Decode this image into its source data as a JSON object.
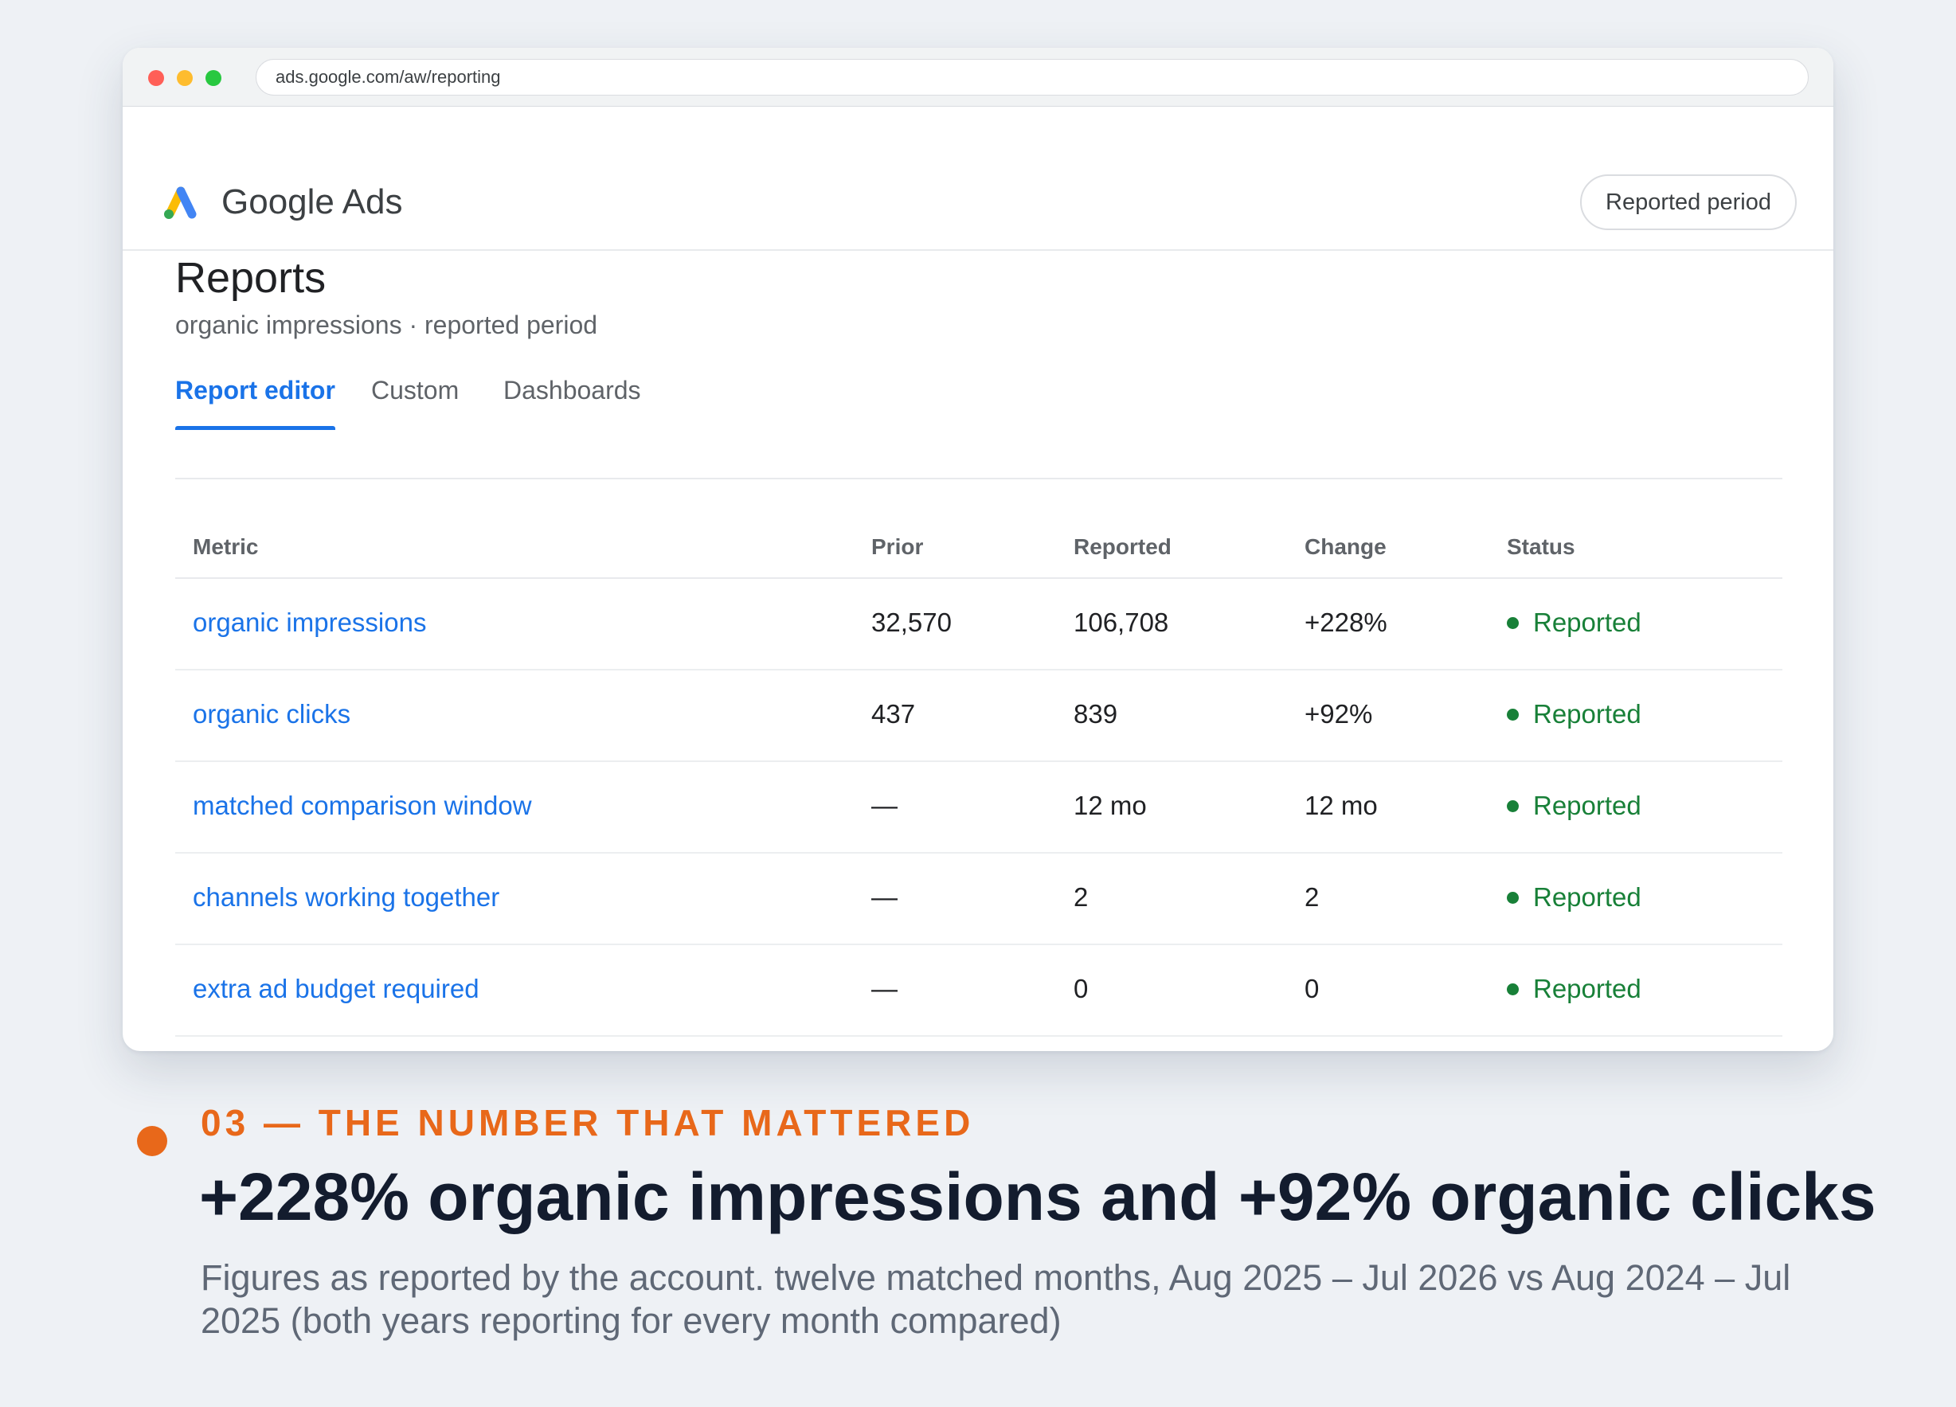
{
  "browser": {
    "url": "ads.google.com/aw/reporting"
  },
  "app": {
    "name": "Google Ads",
    "period_button": "Reported period"
  },
  "page": {
    "title": "Reports",
    "subtitle": "organic impressions · reported period"
  },
  "tabs": [
    {
      "label": "Report editor",
      "active": true
    },
    {
      "label": "Custom",
      "active": false
    },
    {
      "label": "Dashboards",
      "active": false
    }
  ],
  "table": {
    "columns": [
      "Metric",
      "Prior",
      "Reported",
      "Change",
      "Status"
    ],
    "rows": [
      {
        "metric": "organic impressions",
        "prior": "32,570",
        "reported": "106,708",
        "change": "+228%",
        "status": "Reported"
      },
      {
        "metric": "organic clicks",
        "prior": "437",
        "reported": "839",
        "change": "+92%",
        "status": "Reported"
      },
      {
        "metric": "matched comparison window",
        "prior": "—",
        "reported": "12 mo",
        "change": "12 mo",
        "status": "Reported"
      },
      {
        "metric": "channels working together",
        "prior": "—",
        "reported": "2",
        "change": "2",
        "status": "Reported"
      },
      {
        "metric": "extra ad budget required",
        "prior": "—",
        "reported": "0",
        "change": "0",
        "status": "Reported"
      }
    ]
  },
  "caption": {
    "eyebrow": "03 — THE NUMBER THAT MATTERED",
    "headline": "+228% organic impressions and +92% organic clicks",
    "footnote": "Figures as reported by the account. twelve matched months, Aug 2025 – Jul 2026 vs Aug 2024 – Jul 2025 (both years reporting for every month compared)"
  },
  "colors": {
    "accent_blue": "#1a73e8",
    "status_green": "#188038",
    "eyebrow_orange": "#e8681a",
    "background": "#eef1f5"
  },
  "icons": [
    "google-ads-logo-icon",
    "status-dot-icon"
  ]
}
